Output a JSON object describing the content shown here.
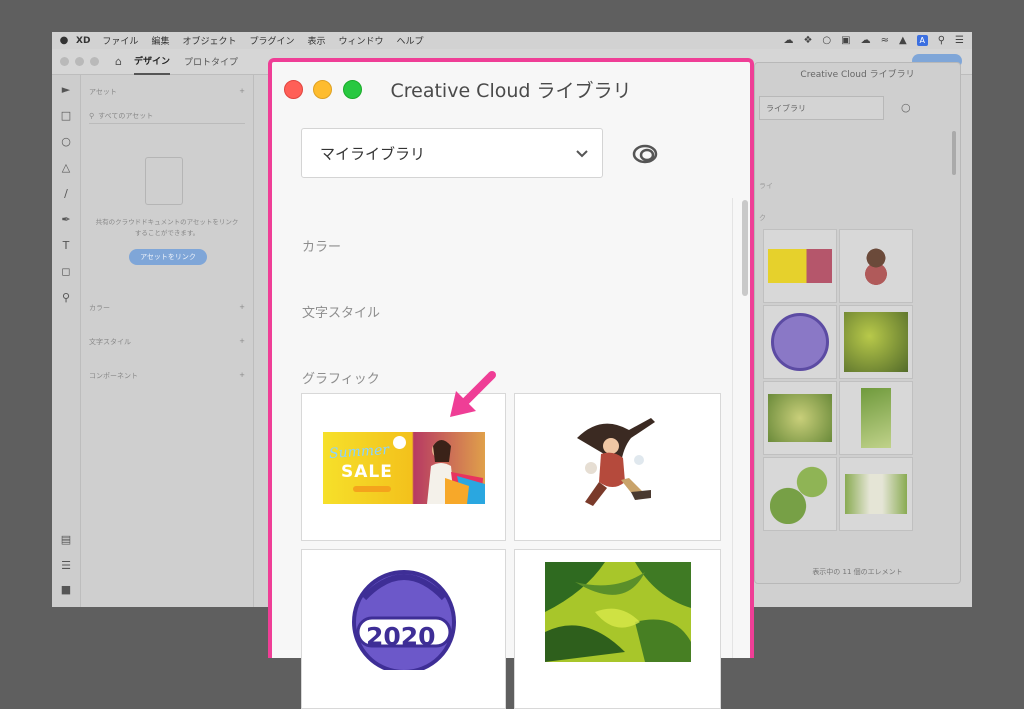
{
  "menubar": {
    "app": "XD",
    "items": [
      "ファイル",
      "編集",
      "オブジェクト",
      "プラグイン",
      "表示",
      "ウィンドウ",
      "ヘルプ"
    ],
    "badge": "A"
  },
  "xd": {
    "tabs": [
      "デザイン",
      "プロトタイプ"
    ],
    "assets_label": "アセット",
    "search_placeholder": "すべてのアセット",
    "empty_text": "共有のクラウドドキュメントのアセットをリンクすることができます。",
    "link_button": "アセットをリンク",
    "sections": [
      "カラー",
      "文字スタイル",
      "コンポーネント"
    ],
    "right_panel_title": "Creative Cloud ライブラリ",
    "right_panel_select": "ライブラリ",
    "right_panel_labels": [
      "ライ",
      "ク"
    ],
    "right_panel_footer": "表示中の 11 個のエレメント"
  },
  "modal": {
    "title": "Creative Cloud ライブラリ",
    "library_select": "マイライブラリ",
    "sections": {
      "colors": "カラー",
      "text_styles": "文字スタイル",
      "graphics": "グラフィック"
    },
    "graphics": [
      {
        "name": "summer-sale-banner",
        "script": "Summer",
        "title": "SALE"
      },
      {
        "name": "anime-warrior-girl"
      },
      {
        "name": "2020-badge",
        "text": "2020"
      },
      {
        "name": "jungle-leaves"
      }
    ]
  },
  "colors": {
    "highlight": "#ef3e96",
    "arrow": "#ef3e96",
    "close": "#ff5f57",
    "minimize": "#febc2e",
    "zoom": "#28c840",
    "link_button": "#7fa6d8"
  }
}
